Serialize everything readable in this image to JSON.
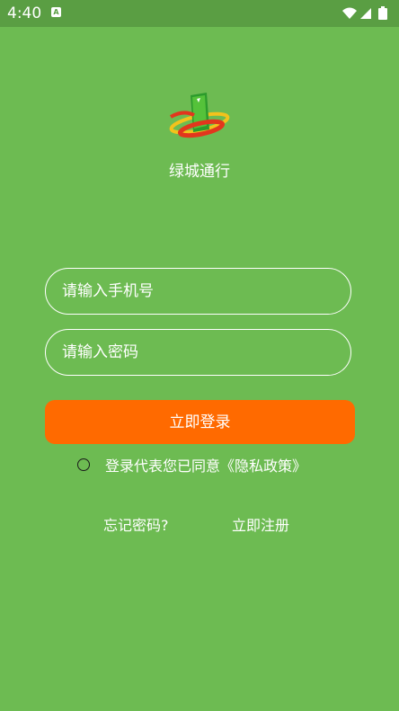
{
  "status_bar": {
    "time": "4:40",
    "notification_icon": "a-icon",
    "wifi_icon": "wifi-icon",
    "signal_icon": "signal-icon",
    "battery_icon": "battery-icon"
  },
  "app": {
    "logo_icon": "app-logo-icon",
    "name": "绿城通行"
  },
  "login_form": {
    "phone_placeholder": "请输入手机号",
    "phone_value": "",
    "password_placeholder": "请输入密码",
    "password_value": "",
    "login_label": "立即登录",
    "agreement_text": "登录代表您已同意《隐私政策》",
    "agreement_checked": false
  },
  "links": {
    "forgot_password": "忘记密码?",
    "register": "立即注册"
  },
  "colors": {
    "background": "#6dbb52",
    "status_bar": "#5a9e43",
    "button": "#ff6a00",
    "text": "#ffffff"
  }
}
